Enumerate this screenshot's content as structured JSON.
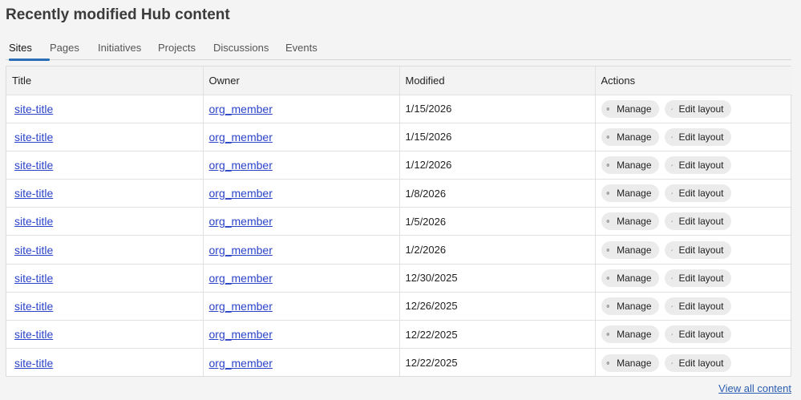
{
  "page": {
    "title": "Recently modified Hub content"
  },
  "tabs": [
    {
      "label": "Sites",
      "active": true
    },
    {
      "label": "Pages",
      "active": false
    },
    {
      "label": "Initiatives",
      "active": false
    },
    {
      "label": "Projects",
      "active": false
    },
    {
      "label": "Discussions",
      "active": false
    },
    {
      "label": "Events",
      "active": false
    }
  ],
  "table": {
    "headers": {
      "title": "Title",
      "owner": "Owner",
      "modified": "Modified",
      "actions": "Actions"
    },
    "action_labels": {
      "manage": "Manage",
      "edit_layout": "Edit layout"
    },
    "rows": [
      {
        "title": "site-title",
        "owner": "org_member",
        "modified": "1/15/2026"
      },
      {
        "title": "site-title",
        "owner": "org_member",
        "modified": "1/15/2026"
      },
      {
        "title": "site-title",
        "owner": "org_member",
        "modified": "1/12/2026"
      },
      {
        "title": "site-title",
        "owner": "org_member",
        "modified": "1/8/2026"
      },
      {
        "title": "site-title",
        "owner": "org_member",
        "modified": "1/5/2026"
      },
      {
        "title": "site-title",
        "owner": "org_member",
        "modified": "1/2/2026"
      },
      {
        "title": "site-title",
        "owner": "org_member",
        "modified": "12/30/2025"
      },
      {
        "title": "site-title",
        "owner": "org_member",
        "modified": "12/26/2025"
      },
      {
        "title": "site-title",
        "owner": "org_member",
        "modified": "12/22/2025"
      },
      {
        "title": "site-title",
        "owner": "org_member",
        "modified": "12/22/2025"
      }
    ]
  },
  "footer": {
    "view_all_label": "View all content"
  },
  "icons": {
    "manage": "gear-icon",
    "edit_layout": "pencil-icon"
  },
  "colors": {
    "link": "#2b43c9",
    "tab_indicator": "#2a6eb8",
    "chip_bg": "#ebebeb"
  }
}
